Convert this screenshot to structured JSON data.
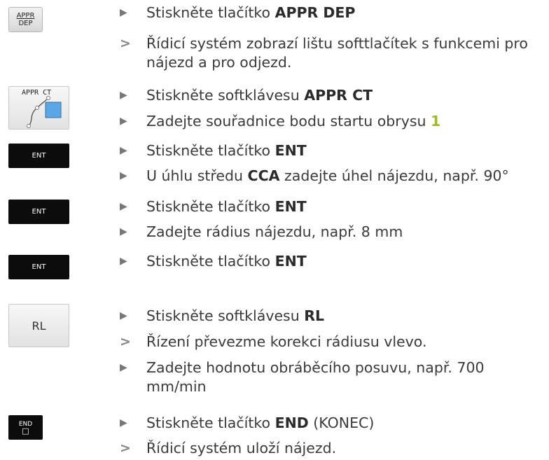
{
  "keys": {
    "appr_dep": {
      "line1": "APPR",
      "line2": "DEP"
    },
    "appr_ct": {
      "label": "APPR CT"
    },
    "ent": {
      "label": "ENT"
    },
    "rl": {
      "label": "RL"
    },
    "end": {
      "label": "END",
      "symbol": "□"
    }
  },
  "steps": [
    {
      "type": "action",
      "pre": "Stiskněte tlačítko ",
      "bold": "APPR DEP",
      "post": ""
    },
    {
      "type": "result",
      "text": "Řídicí systém zobrazí lištu softtlačítek s funkcemi pro nájezd a pro odjezd."
    },
    {
      "type": "action",
      "pre": "Stiskněte softklávesu ",
      "bold": "APPR CT",
      "post": ""
    },
    {
      "type": "action",
      "pre": "Zadejte souřadnice bodu startu obrysu ",
      "bold": "1",
      "post": ""
    },
    {
      "type": "action",
      "pre": "Stiskněte tlačítko ",
      "bold": "ENT",
      "post": ""
    },
    {
      "type": "action",
      "pre": "U úhlu středu ",
      "bold": "CCA",
      "post": " zadejte úhel nájezdu, např. 90°"
    },
    {
      "type": "action",
      "pre": "Stiskněte tlačítko ",
      "bold": "ENT",
      "post": ""
    },
    {
      "type": "action",
      "pre": "Zadejte rádius nájezdu, např. 8 mm",
      "bold": "",
      "post": ""
    },
    {
      "type": "action",
      "pre": "Stiskněte tlačítko ",
      "bold": "ENT",
      "post": ""
    },
    {
      "type": "action",
      "pre": "Stiskněte softklávesu ",
      "bold": "RL",
      "post": ""
    },
    {
      "type": "result",
      "text": "Řízení převezme korekci rádiusu vlevo."
    },
    {
      "type": "action",
      "pre": "Zadejte hodnotu obráběcího posuvu, např. 700 mm/min",
      "bold": "",
      "post": ""
    },
    {
      "type": "action",
      "pre": "Stiskněte tlačítko ",
      "bold": "END",
      "post": " (KONEC)"
    },
    {
      "type": "result",
      "text": "Řídicí systém uloží nájezd."
    }
  ],
  "colors": {
    "accent": "#9bbf1c",
    "text": "#3a3a3a",
    "dark_key": "#0c0c0c"
  }
}
